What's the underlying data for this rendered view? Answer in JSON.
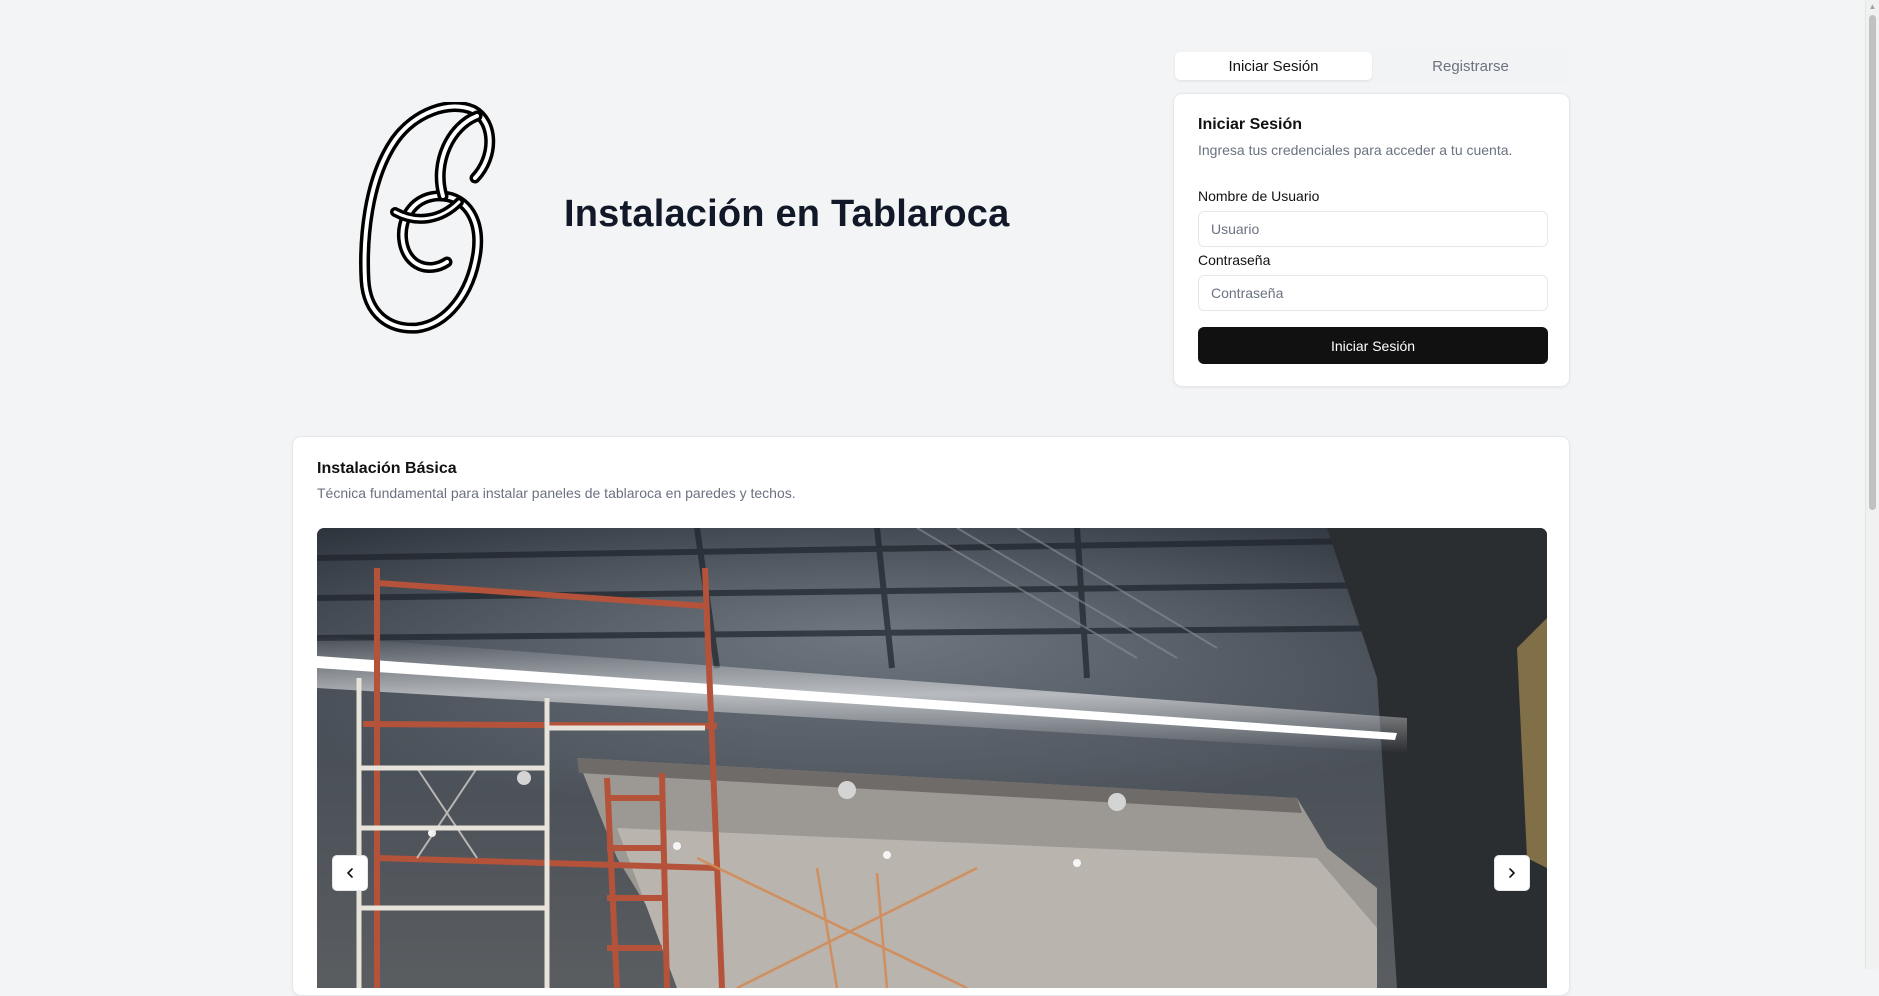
{
  "header": {
    "title": "Instalación en Tablaroca",
    "logo_icon": "swirl-g-logo"
  },
  "auth": {
    "tabs": [
      {
        "label": "Iniciar Sesión",
        "active": true
      },
      {
        "label": "Registrarse",
        "active": false
      }
    ],
    "login": {
      "title": "Iniciar Sesión",
      "description": "Ingresa tus credenciales para acceder a tu cuenta.",
      "username_label": "Nombre de Usuario",
      "username_placeholder": "Usuario",
      "username_value": "",
      "password_label": "Contraseña",
      "password_placeholder": "Contraseña",
      "password_value": "",
      "submit_label": "Iniciar Sesión"
    }
  },
  "section": {
    "title": "Instalación Básica",
    "description": "Técnica fundamental para instalar paneles de tablaroca en paredes y techos.",
    "carousel": {
      "prev_icon": "chevron-left-icon",
      "next_icon": "chevron-right-icon"
    }
  },
  "colors": {
    "page_bg": "#f3f4f6",
    "primary_button": "#111111",
    "muted_text": "#6b7280"
  }
}
